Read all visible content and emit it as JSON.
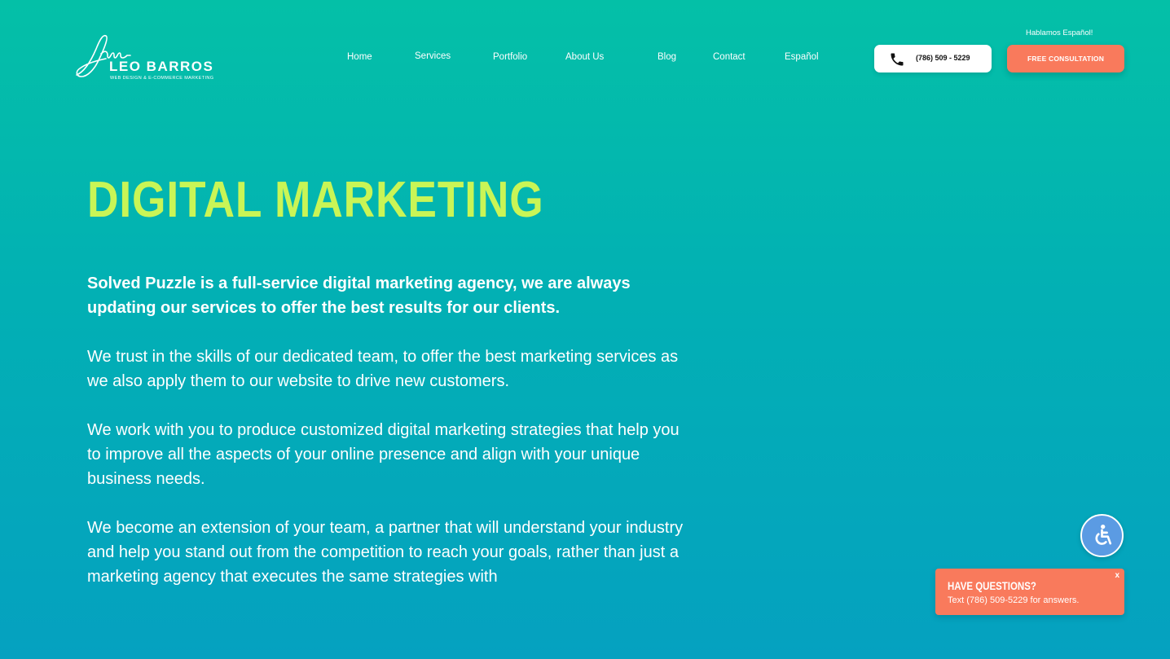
{
  "brand": {
    "name": "LEO BARROS",
    "tagline": "WEB DESIGN & E-COMMERCE MARKETING"
  },
  "nav": {
    "items": [
      {
        "label": "Home"
      },
      {
        "label": "Services"
      },
      {
        "label": "Portfolio"
      },
      {
        "label": "About Us"
      },
      {
        "label": "Blog"
      },
      {
        "label": "Contact"
      },
      {
        "label": "Español"
      }
    ]
  },
  "header": {
    "hablamos": "Hablamos Español!",
    "phone": "(786) 509 - 5229",
    "cta": "FREE CONSULTATION"
  },
  "hero": {
    "title": "DIGITAL MARKETING",
    "lead": "Solved Puzzle is a full-service digital marketing agency, we are always updating our services to offer the best results for our clients.",
    "paragraphs": [
      "We trust in the skills of our dedicated team, to offer the best marketing services as we also apply them to our website to drive new customers.",
      "We work with you to produce customized digital marketing strategies that help you to improve all the aspects of your online presence and align with your unique business needs.",
      "We become an extension of your team, a partner that will understand your industry and help you stand out from the competition to reach your goals, rather than just a marketing agency that executes the same strategies with"
    ]
  },
  "chat": {
    "title": "HAVE QUESTIONS?",
    "subtitle": "Text (786) 509-5229 for answers.",
    "close": "x"
  },
  "colors": {
    "accent_title": "#c9f556",
    "cta": "#f97a5c",
    "accessibility": "#5b9be3"
  },
  "icons": {
    "phone": "phone-icon",
    "accessibility": "accessibility-icon"
  }
}
